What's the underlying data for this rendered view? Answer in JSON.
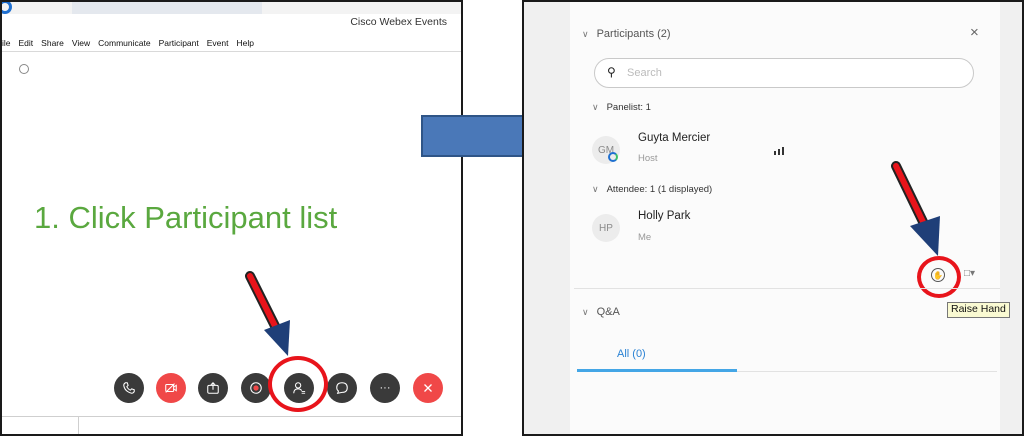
{
  "left_panel": {
    "app_title": "Cisco Webex Events",
    "menu": [
      "ile",
      "Edit",
      "Share",
      "View",
      "Communicate",
      "Participant",
      "Event",
      "Help"
    ],
    "instruction": "1. Click Participant list",
    "controls": [
      {
        "name": "phone-button",
        "icon": "phone-icon",
        "color": "#3a3a3a"
      },
      {
        "name": "video-button",
        "icon": "video-off-icon",
        "color": "#f04848"
      },
      {
        "name": "share-button",
        "icon": "share-icon",
        "color": "#3a3a3a"
      },
      {
        "name": "record-button",
        "icon": "record-icon",
        "color": "#3a3a3a"
      },
      {
        "name": "participants-button",
        "icon": "participants-icon",
        "color": "#3a3a3a"
      },
      {
        "name": "chat-button",
        "icon": "chat-icon",
        "color": "#3a3a3a"
      },
      {
        "name": "more-button",
        "icon": "more-icon",
        "color": "#3a3a3a"
      },
      {
        "name": "leave-button",
        "icon": "close-icon",
        "color": "#f04848"
      }
    ],
    "more_label": "···"
  },
  "right_panel": {
    "participants_header": "Participants (2)",
    "close_label": "×",
    "search_placeholder": "Search",
    "panelist_section": "Panelist: 1",
    "panelist": {
      "initials": "GM",
      "name": "Guyta Mercier",
      "role": "Host"
    },
    "attendee_section": "Attendee: 1 (1 displayed)",
    "attendee": {
      "initials": "HP",
      "name": "Holly Park",
      "role": "Me"
    },
    "tooltip": "Raise Hand",
    "qa_header": "Q&A",
    "qa_tab": "All (0)"
  },
  "colors": {
    "highlight_red": "#e8141b",
    "instruction_green": "#5aa83f",
    "arrow_blue": "#4a78b8"
  }
}
